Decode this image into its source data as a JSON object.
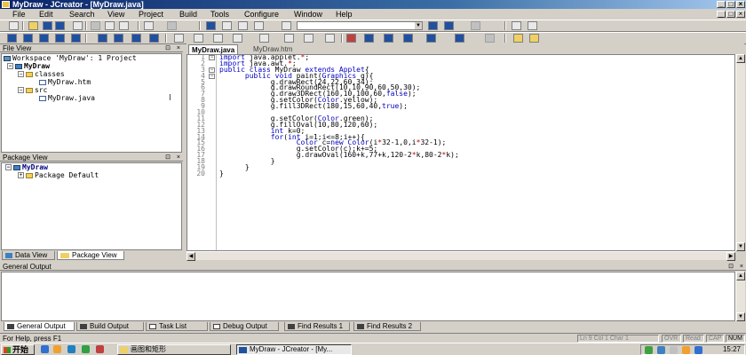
{
  "window": {
    "title": "MyDraw - JCreator - [MyDraw.java]"
  },
  "menu": [
    "File",
    "Edit",
    "Search",
    "View",
    "Project",
    "Build",
    "Tools",
    "Configure",
    "Window",
    "Help"
  ],
  "file_view": {
    "title": "File View",
    "workspace": "Workspace 'MyDraw': 1 Project",
    "project": "MyDraw",
    "folders": [
      "classes",
      "src"
    ],
    "files": [
      "MyDraw.htm",
      "MyDraw.java"
    ]
  },
  "package_view": {
    "title": "Package View",
    "project": "MyDraw",
    "package": "Package Default"
  },
  "left_tabs": [
    "Data View",
    "Package View"
  ],
  "editor": {
    "tabs": [
      "MyDraw.java",
      "MyDraw.htm"
    ],
    "line_numbers": [
      "1",
      "2",
      "3",
      "4",
      "5",
      "6",
      "7",
      "8",
      "9",
      "10",
      "11",
      "12",
      "13",
      "14",
      "15",
      "16",
      "17",
      "18",
      "19",
      "20"
    ],
    "lines": [
      "import java.applet.*;",
      "import java.awt.*;",
      "public class MyDraw extends Applet{",
      "      public void paint(Graphics g){",
      "            g.drawRect(24,22,60,34);",
      "            g.drawRoundRect(10,10,90,60,50,30);",
      "            g.draw3DRect(160,10,100,60,false);",
      "            g.setColor(Color.yellow);",
      "            g.fill3DRect(180,15,60,40,true);",
      "",
      "            g.setColor(Color.green);",
      "            g.fillOval(10,80,120,60);",
      "            int k=0;",
      "            for(int i=1;i<=8;i++){",
      "                  Color c=new Color(i*32-1,0,i*32-1);",
      "                  g.setColor(c);k+=5;",
      "                  g.drawOval(160+k,77+k,120-2*k,80-2*k);",
      "            }",
      "      }",
      "}"
    ]
  },
  "output": {
    "title": "General Output"
  },
  "output_tabs": [
    "General Output",
    "Build Output",
    "Task List",
    "Debug Output",
    "Find Results 1",
    "Find Results 2"
  ],
  "status": {
    "help": "For Help, press F1",
    "position": "Ln 9   Col 1   Char 1",
    "indicators": [
      "OVR",
      "Read",
      "CAP",
      "NUM"
    ]
  },
  "taskbar": {
    "start": "开始",
    "tasks": [
      "画图和矩形",
      "MyDraw - JCreator - [My..."
    ],
    "clock": "15:27"
  }
}
